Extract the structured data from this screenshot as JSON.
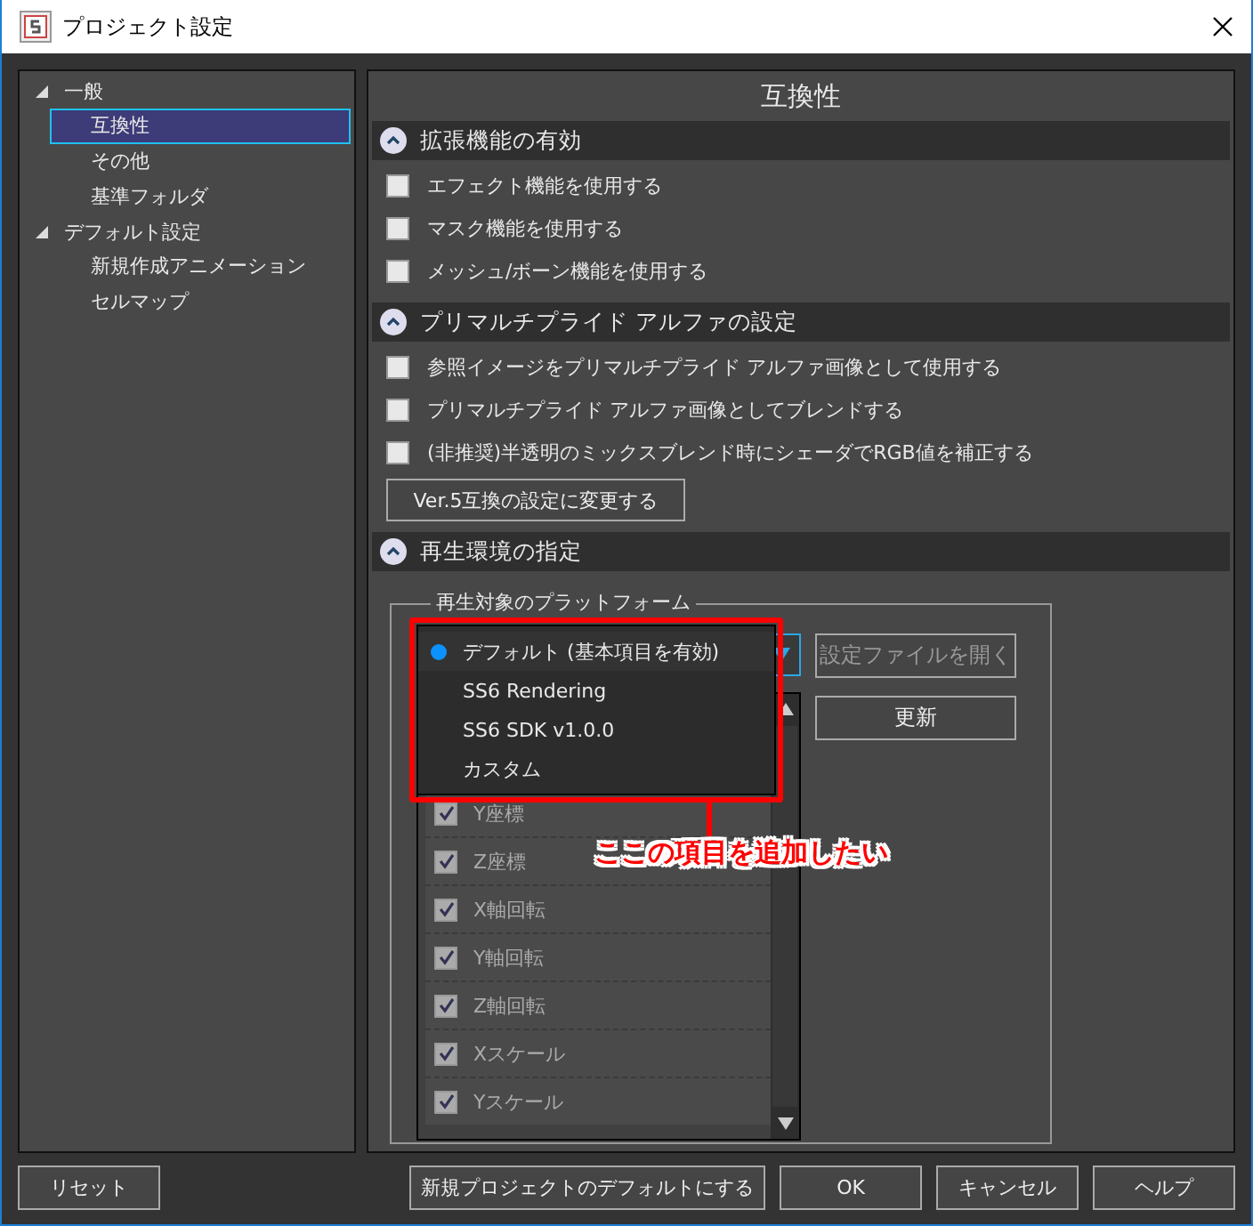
{
  "window": {
    "title": "プロジェクト設定"
  },
  "tree": [
    {
      "label": "一般",
      "expanded": true,
      "children": [
        {
          "label": "互換性",
          "selected": true
        },
        {
          "label": "その他",
          "selected": false
        },
        {
          "label": "基準フォルダ",
          "selected": false
        }
      ]
    },
    {
      "label": "デフォルト設定",
      "expanded": true,
      "children": [
        {
          "label": "新規作成アニメーション",
          "selected": false
        },
        {
          "label": "セルマップ",
          "selected": false
        }
      ]
    }
  ],
  "panel_title": "互換性",
  "sections": [
    {
      "title": "拡張機能の有効",
      "expanded": true,
      "items": [
        {
          "kind": "checkbox",
          "label": "エフェクト機能を使用する",
          "checked": false
        },
        {
          "kind": "checkbox",
          "label": "マスク機能を使用する",
          "checked": false
        },
        {
          "kind": "checkbox",
          "label": "メッシュ/ボーン機能を使用する",
          "checked": false
        }
      ]
    },
    {
      "title": "プリマルチプライド アルファの設定",
      "expanded": true,
      "items": [
        {
          "kind": "checkbox",
          "label": "参照イメージをプリマルチプライド アルファ画像として使用する",
          "checked": false
        },
        {
          "kind": "checkbox",
          "label": "プリマルチプライド アルファ画像としてブレンドする",
          "checked": false
        },
        {
          "kind": "checkbox",
          "label": "(非推奨)半透明のミックスブレンド時にシェーダでRGB値を補正する",
          "checked": false
        },
        {
          "kind": "button",
          "label": "Ver.5互換の設定に変更する"
        }
      ]
    },
    {
      "title": "再生環境の指定",
      "expanded": true,
      "items": [
        {
          "kind": "platform"
        }
      ]
    }
  ],
  "platform": {
    "legend": "再生対象のプラットフォーム",
    "options": [
      {
        "label": "デフォルト (基本項目を有効)",
        "selected": true
      },
      {
        "label": "SS6 Rendering",
        "selected": false
      },
      {
        "label": "SS6 SDK v1.0.0",
        "selected": false
      },
      {
        "label": "カスタム",
        "selected": false
      }
    ],
    "buttons": [
      {
        "label": "設定ファイルを開く",
        "disabled": true
      },
      {
        "label": "更新",
        "disabled": false
      }
    ],
    "rows": [
      {
        "label": "Y座標",
        "checked": true
      },
      {
        "label": "Z座標",
        "checked": true
      },
      {
        "label": "X軸回転",
        "checked": true
      },
      {
        "label": "Y軸回転",
        "checked": true
      },
      {
        "label": "Z軸回転",
        "checked": true
      },
      {
        "label": "Xスケール",
        "checked": true
      },
      {
        "label": "Yスケール",
        "checked": true
      }
    ]
  },
  "annotation": {
    "text": "ここの項目を追加したい"
  },
  "footer": {
    "left": "リセット",
    "buttons": [
      "新規プロジェクトのデフォルトにする",
      "OK",
      "キャンセル",
      "ヘルプ"
    ]
  }
}
